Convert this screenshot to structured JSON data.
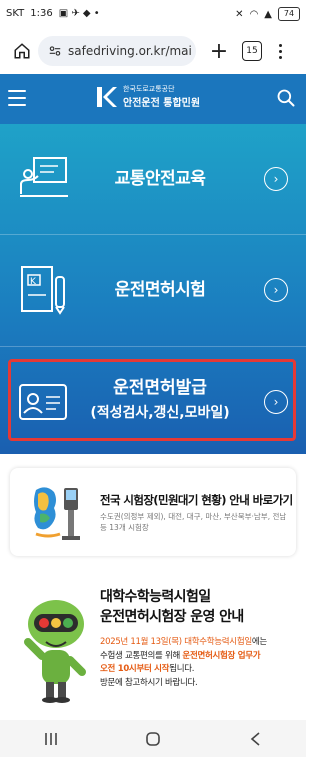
{
  "status_bar": {
    "carrier": "SKT",
    "time": "1:36",
    "battery": "74"
  },
  "browser": {
    "url": "safedriving.or.kr/mai",
    "tab_count": "15"
  },
  "site_header": {
    "org_name_small": "한국도로교통공단",
    "org_name": "안전운전 통합민원"
  },
  "menu": {
    "items": [
      {
        "label": "교통안전교육",
        "icon": "monitor-presentation-icon"
      },
      {
        "label": "운전면허시험",
        "icon": "document-pen-icon"
      },
      {
        "label": "운전면허발급",
        "sublabel": "(적성검사,갱신,모바일)",
        "icon": "id-card-icon"
      }
    ]
  },
  "banner_exam_center": {
    "title": "전국 시험장(민원대기 현황) 안내 바로가기",
    "description": "수도권(의정부 제외), 대전, 대구, 마산, 부산북부·남부, 전남 등 13개 시험장"
  },
  "banner_csat": {
    "headline1": "대학수학능력시험일",
    "headline2": "운전면허시험장 운영 안내",
    "line1_date": "2025년 11월 13일(목) ",
    "line1_event": "대학수학능력시험일",
    "line1_rest": "에는",
    "line2_pre": "수험생 교통편의를 위해 ",
    "line2_highlight": "운전면허시험장 업무가",
    "line3_highlight": "오전 10시부터 시작",
    "line3_rest": "됩니다.",
    "line4": "방문에 참고하시기 바랍니다."
  },
  "colors": {
    "header_blue": "#1b76bd",
    "highlight_red": "#e53935",
    "accent_orange": "#e55a12"
  }
}
